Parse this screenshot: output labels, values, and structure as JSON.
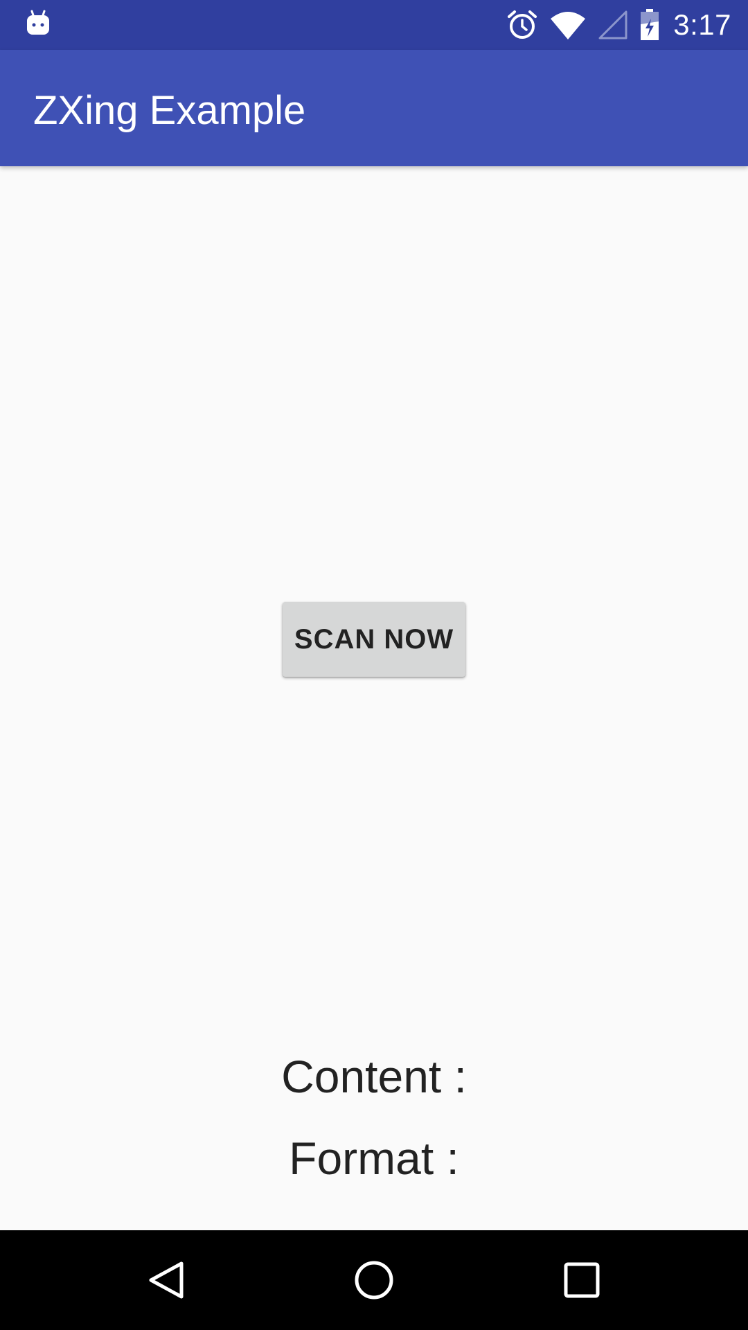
{
  "status_bar": {
    "time": "3:17",
    "icons": [
      "android-debug-icon",
      "alarm-icon",
      "wifi-icon",
      "cell-signal-icon",
      "battery-charging-icon"
    ]
  },
  "app_bar": {
    "title": "ZXing Example"
  },
  "main": {
    "scan_button_label": "SCAN NOW",
    "content_label": "Content :",
    "format_label": "Format :"
  },
  "nav_bar": {
    "icons": [
      "back-icon",
      "home-icon",
      "recents-icon"
    ]
  },
  "colors": {
    "status_bar": "#303f9f",
    "app_bar": "#3f51b5",
    "background": "#fafafa",
    "button": "#d6d7d7"
  }
}
